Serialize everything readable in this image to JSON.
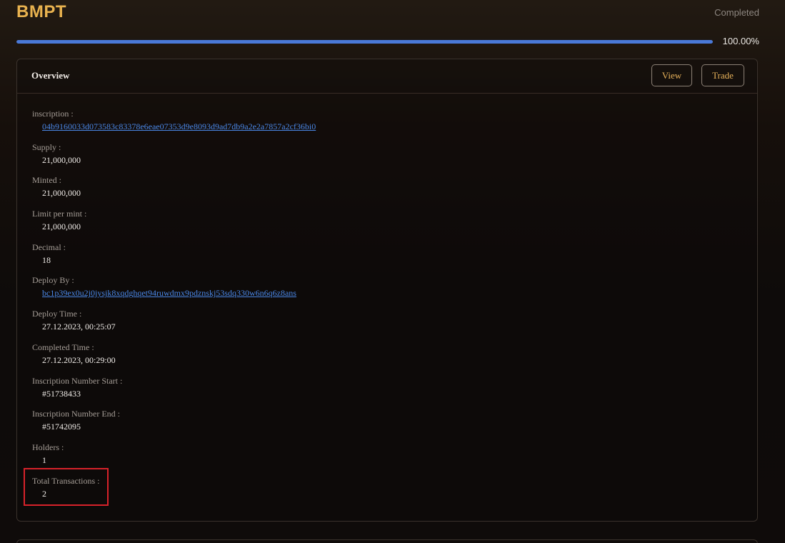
{
  "header": {
    "title": "BMPT",
    "status": "Completed"
  },
  "progress": {
    "label": "100.00%",
    "fraction": 1.0,
    "color": "#4a79d8"
  },
  "overview": {
    "title": "Overview",
    "view_label": "View",
    "trade_label": "Trade",
    "fields": [
      {
        "label": "inscription :",
        "value": "04b9160033d073583c83378e6eae07353d9e8093d9ad7db9a2e2a7857a2cf36bi0",
        "link": true
      },
      {
        "label": "Supply :",
        "value": "21,000,000",
        "link": false
      },
      {
        "label": "Minted :",
        "value": "21,000,000",
        "link": false
      },
      {
        "label": "Limit per mint :",
        "value": "21,000,000",
        "link": false
      },
      {
        "label": "Decimal :",
        "value": "18",
        "link": false
      },
      {
        "label": "Deploy By :",
        "value": "bc1p39ex0u2j0jysjk8xqdghqet94ruwdmx9pdznskj53sdq330w6n6q6z8ans",
        "link": true
      },
      {
        "label": "Deploy Time :",
        "value": "27.12.2023, 00:25:07",
        "link": false
      },
      {
        "label": "Completed Time :",
        "value": "27.12.2023, 00:29:00",
        "link": false
      },
      {
        "label": "Inscription Number Start :",
        "value": "#51738433",
        "link": false
      },
      {
        "label": "Inscription Number End :",
        "value": "#51742095",
        "link": false
      },
      {
        "label": "Holders :",
        "value": "1",
        "link": false
      },
      {
        "label": "Total Transactions :",
        "value": "2",
        "link": false
      }
    ]
  },
  "colors": {
    "accent": "#e8b24f",
    "link": "#4a87e6",
    "highlight_box": "#d7222a"
  }
}
